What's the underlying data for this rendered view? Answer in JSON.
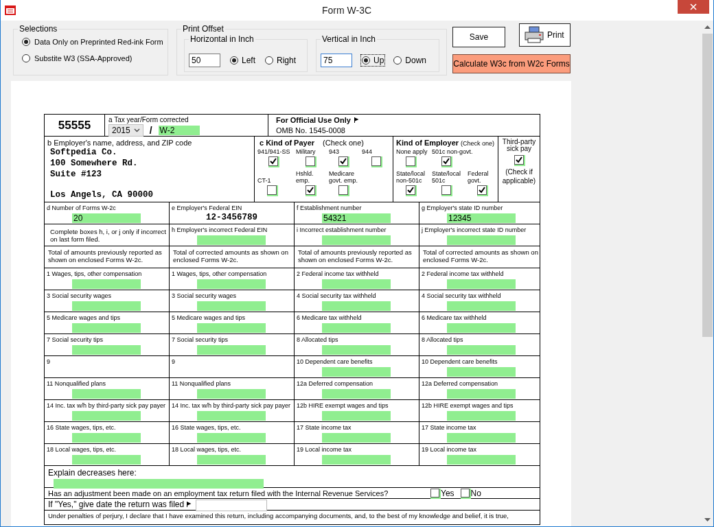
{
  "window": {
    "title": "Form W-3C"
  },
  "selections": {
    "legend": "Selections",
    "options": [
      {
        "label": "Data Only on Preprinted Red-ink Form",
        "selected": true
      },
      {
        "label": "Substite W3 (SSA-Approved)",
        "selected": false
      }
    ]
  },
  "print_offset": {
    "legend": "Print Offset",
    "groups": [
      {
        "legend": "Horizontal in Inch",
        "value": "50",
        "options": [
          {
            "label": "Left",
            "selected": true
          },
          {
            "label": "Right",
            "selected": false
          }
        ]
      },
      {
        "legend": "Vertical in Inch",
        "value": "75",
        "options": [
          {
            "label": "Up",
            "selected": true
          },
          {
            "label": "Down",
            "selected": false
          }
        ]
      }
    ]
  },
  "buttons": {
    "save": "Save",
    "print": "Print",
    "calculate": "Calculate W3c from W2c Forms"
  },
  "form": {
    "code": "55555",
    "tax_year_label": "a  Tax year/Form corrected",
    "year": "2015",
    "separator": "/",
    "form_corrected": "W-2",
    "official": "For Official Use Only",
    "omb": "OMB No. 1545-0008",
    "employer": {
      "label": "b Employer's name, address, and ZIP code",
      "lines": [
        "Softpedia Co.",
        "100 Somewhere Rd.",
        "Suite #123"
      ],
      "city": "Los Angels, CA 90000"
    },
    "payer": {
      "title": "c  Kind of Payer",
      "note": "(Check one)",
      "boxes": [
        {
          "label": "941/941-SS",
          "checked": true
        },
        {
          "label": "Military",
          "checked": false
        },
        {
          "label": "943",
          "checked": true
        },
        {
          "label": "944",
          "checked": false
        },
        {
          "label": "CT-1",
          "checked": false
        },
        {
          "label": "Hshld. emp.",
          "checked": true
        },
        {
          "label": "Medicare govt. emp.",
          "checked": false
        }
      ]
    },
    "employer_kind": {
      "title": "Kind of Employer",
      "note": "(Check one)",
      "boxes": [
        {
          "label": "None apply",
          "checked": false
        },
        {
          "label": "501c non-govt.",
          "checked": true
        },
        {
          "label": "State/local non-501c",
          "checked": true
        },
        {
          "label": "State/local 501c",
          "checked": false
        },
        {
          "label": "Federal govt.",
          "checked": true
        }
      ]
    },
    "third_party": {
      "label": "Third-party sick pay",
      "checked": true,
      "note": "(Check if applicable)"
    },
    "ids": [
      {
        "label": "d  Number of Forms W-2c",
        "value": "20",
        "kind": "field"
      },
      {
        "label": "e  Employer's Federal EIN",
        "value": "12-3456789",
        "kind": "plain"
      },
      {
        "label": "f  Establishment number",
        "value": "54321",
        "kind": "field"
      },
      {
        "label": "g  Employer's state ID number",
        "value": "12345",
        "kind": "field"
      }
    ],
    "incorrect": [
      {
        "label": "Complete boxes h, i, or j only if incorrect on last form filed.",
        "kind": "note"
      },
      {
        "label": "h  Employer's incorrect Federal EIN",
        "kind": "field"
      },
      {
        "label": "i  Incorrect establishment number",
        "kind": "field"
      },
      {
        "label": "j  Employer's incorrect state ID number",
        "kind": "field"
      }
    ],
    "totals_headers": [
      "Total of amounts previously reported as shown on enclosed Forms W-2c.",
      "Total of corrected amounts as shown on enclosed Forms W-2c.",
      "Total of amounts previously reported as shown on enclosed Forms W-2c.",
      "Total of corrected amounts as shown on enclosed Forms W-2c."
    ],
    "amount_rows": [
      [
        {
          "label": "1  Wages, tips, other compensation",
          "kind": "amount"
        },
        {
          "label": "1  Wages, tips, other compensation",
          "kind": "amount"
        },
        {
          "label": "2  Federal income tax withheld",
          "kind": "amount"
        },
        {
          "label": "2  Federal income tax withheld",
          "kind": "amount"
        }
      ],
      [
        {
          "label": "3  Social security wages",
          "kind": "amount"
        },
        {
          "label": "3  Social security wages",
          "kind": "amount"
        },
        {
          "label": "4  Social security tax withheld",
          "kind": "amount"
        },
        {
          "label": "4  Social security tax withheld",
          "kind": "amount"
        }
      ],
      [
        {
          "label": "5  Medicare wages and tips",
          "kind": "amount"
        },
        {
          "label": "5  Medicare wages and tips",
          "kind": "amount"
        },
        {
          "label": "6  Medicare tax withheld",
          "kind": "amount"
        },
        {
          "label": "6  Medicare tax withheld",
          "kind": "amount"
        }
      ],
      [
        {
          "label": "7  Social security tips",
          "kind": "amount"
        },
        {
          "label": "7  Social security tips",
          "kind": "amount"
        },
        {
          "label": "8  Allocated tips",
          "kind": "amount"
        },
        {
          "label": "8  Allocated tips",
          "kind": "amount"
        }
      ],
      [
        {
          "label": "9",
          "kind": "label"
        },
        {
          "label": "9",
          "kind": "label"
        },
        {
          "label": "10  Dependent care benefits",
          "kind": "amount"
        },
        {
          "label": "10  Dependent care benefits",
          "kind": "amount"
        }
      ],
      [
        {
          "label": "11  Nonqualified plans",
          "kind": "amount"
        },
        {
          "label": "11  Nonqualified plans",
          "kind": "amount"
        },
        {
          "label": "12a Deferred compensation",
          "kind": "amount"
        },
        {
          "label": "12a Deferred compensation",
          "kind": "amount"
        }
      ],
      [
        {
          "label": "14 Inc. tax w/h by third-party sick pay payer",
          "kind": "amount"
        },
        {
          "label": "14 Inc. tax w/h by third-party sick pay payer",
          "kind": "amount"
        },
        {
          "label": "12b  HIRE exempt wages and tips",
          "kind": "amount"
        },
        {
          "label": "12b  HIRE exempt wages and tips",
          "kind": "amount"
        }
      ],
      [
        {
          "label": "16  State wages, tips, etc.",
          "kind": "amount"
        },
        {
          "label": "16  State wages, tips, etc.",
          "kind": "amount"
        },
        {
          "label": "17  State income tax",
          "kind": "amount"
        },
        {
          "label": "17  State income tax",
          "kind": "amount"
        }
      ],
      [
        {
          "label": "18  Local wages, tips, etc.",
          "kind": "amount"
        },
        {
          "label": "18  Local wages, tips, etc.",
          "kind": "amount"
        },
        {
          "label": "19  Local income tax",
          "kind": "amount"
        },
        {
          "label": "19  Local income tax",
          "kind": "amount"
        }
      ]
    ],
    "explain": "Explain decreases here:",
    "adjustment": {
      "question": "Has an adjustment been made on an employment tax return filed with the Internal Revenue Services?",
      "options": [
        {
          "label": "Yes",
          "checked": false
        },
        {
          "label": "No",
          "checked": false
        }
      ]
    },
    "date_filed": "If \"Yes,\" give date the return was filed",
    "penalties": "Under penalties of perjury, I declare that I have examined this return, including accompanying documents, and, to the best of my knowledge and belief, it is true,"
  }
}
